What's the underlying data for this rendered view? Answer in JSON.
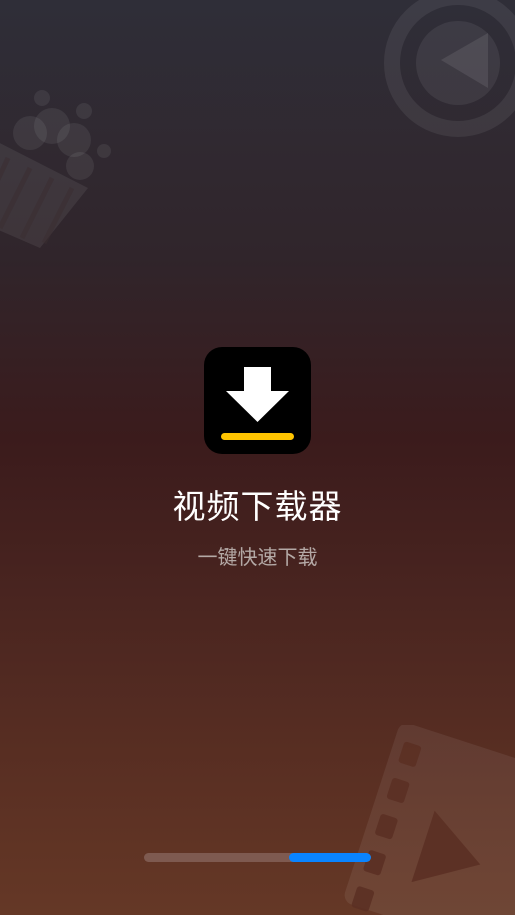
{
  "splash": {
    "title": "视频下载器",
    "subtitle": "一键快速下载"
  },
  "icons": {
    "app": "download-arrow-icon",
    "decorations": [
      "play-button-icon",
      "popcorn-icon",
      "film-strip-icon"
    ]
  },
  "loading": {
    "progress_fraction": 0.36,
    "fill_color": "#0a84ff"
  },
  "colors": {
    "app_icon_background": "#000000",
    "app_icon_arrow": "#ffffff",
    "app_icon_underline": "#ffc400",
    "title": "#ffffff",
    "subtitle": "#b4a9a6"
  }
}
